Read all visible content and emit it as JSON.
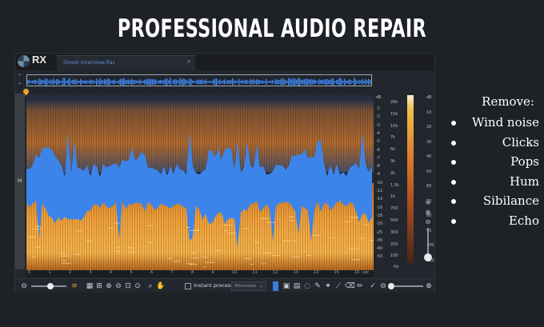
{
  "headline": "PROFESSIONAL AUDIO REPAIR",
  "app": {
    "logo": {
      "text": "RX",
      "subtext": "RX"
    },
    "tab": {
      "name": "Street Interview.flac",
      "close": "×"
    },
    "leftstrip_label": "M",
    "freq_axis": {
      "unit": "Hz",
      "ticks": [
        "20k",
        "15k",
        "10k",
        "7k",
        "5k",
        "3k",
        "2k",
        "1.5k",
        "1k",
        "700",
        "500",
        "300",
        "200",
        "100"
      ]
    },
    "db_axis": {
      "unit": "dB",
      "ticks": [
        "-1",
        "-2",
        "-3",
        "-4",
        "-5",
        "-6",
        "-7",
        "-8",
        "-9",
        "-10",
        "-12",
        "-14",
        "-16",
        "-18",
        "-20",
        "-25",
        "-30",
        "-40",
        "-50"
      ]
    },
    "meter_scale": [
      "dB",
      "10",
      "20",
      "30",
      "40",
      "50",
      "60",
      "70",
      "80",
      "90",
      "100",
      "110"
    ],
    "timeline": {
      "ticks": [
        "0",
        "1",
        "2",
        "3",
        "4",
        "5",
        "6",
        "7",
        "8",
        "9",
        "10",
        "11",
        "12",
        "13",
        "14",
        "15",
        "16"
      ],
      "unit": "sec"
    },
    "toolbar": {
      "instant_process_label": "Instant process",
      "mode_value": "Attenuate",
      "mode_caret": "⌄"
    }
  },
  "sidebar": {
    "heading": "Remove:",
    "items": [
      "Wind noise",
      "Clicks",
      "Pops",
      "Hum",
      "Sibilance",
      "Echo"
    ]
  },
  "colors": {
    "background": "#1e2126",
    "selection_blue": "#3d84ea",
    "spectrum_orange": "#e38a2c",
    "tab_text": "#5e8fd6"
  },
  "icons": [
    "collapse-arrows-icon",
    "waveform-icon",
    "spectrogram-icon",
    "zoom-in-icon",
    "zoom-out-icon",
    "hand-icon",
    "lasso-icon",
    "brush-icon",
    "wand-icon"
  ]
}
